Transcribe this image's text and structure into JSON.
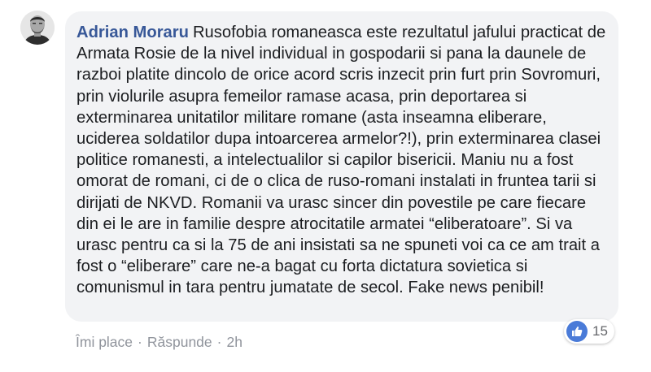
{
  "comment": {
    "author": "Adrian Moraru",
    "text": "Rusofobia romaneasca este rezultatul jafului practicat de Armata Rosie de la nivel individual in gospodarii si pana la daunele de razboi platite dincolo de orice acord scris inzecit prin furt prin Sovromuri, prin violurile asupra femeilor ramase acasa, prin deportarea si exterminarea unitatilor militare romane (asta inseamna eliberare, uciderea soldatilor dupa intoarcerea armelor?!), prin exterminarea clasei politice romanesti, a intelectualilor si capilor bisericii. Maniu nu a fost omorat de romani, ci de o clica de ruso-romani instalati in fruntea tarii si dirijati de NKVD. Romanii va urasc sincer din povestile pe care fiecare din ei le are in familie despre atrocitatile armatei “eliberatoare”. Si va urasc pentru ca si la 75 de ani insistati sa ne spuneti voi ca ce am trait a fost o “eliberare” care ne-a bagat cu forta dictatura sovietica si comunismul in tara pentru jumatate de secol. Fake news penibil!"
  },
  "actions": {
    "like": "Îmi place",
    "reply": "Răspunde",
    "separator": "·",
    "time": "2h"
  },
  "reactions": {
    "icon": "thumbs-up-icon",
    "count": "15",
    "color": "#4a7bd8"
  },
  "colors": {
    "author": "#385898",
    "bubble": "#f2f3f5",
    "text": "#1c1e21",
    "meta": "#90949c"
  }
}
